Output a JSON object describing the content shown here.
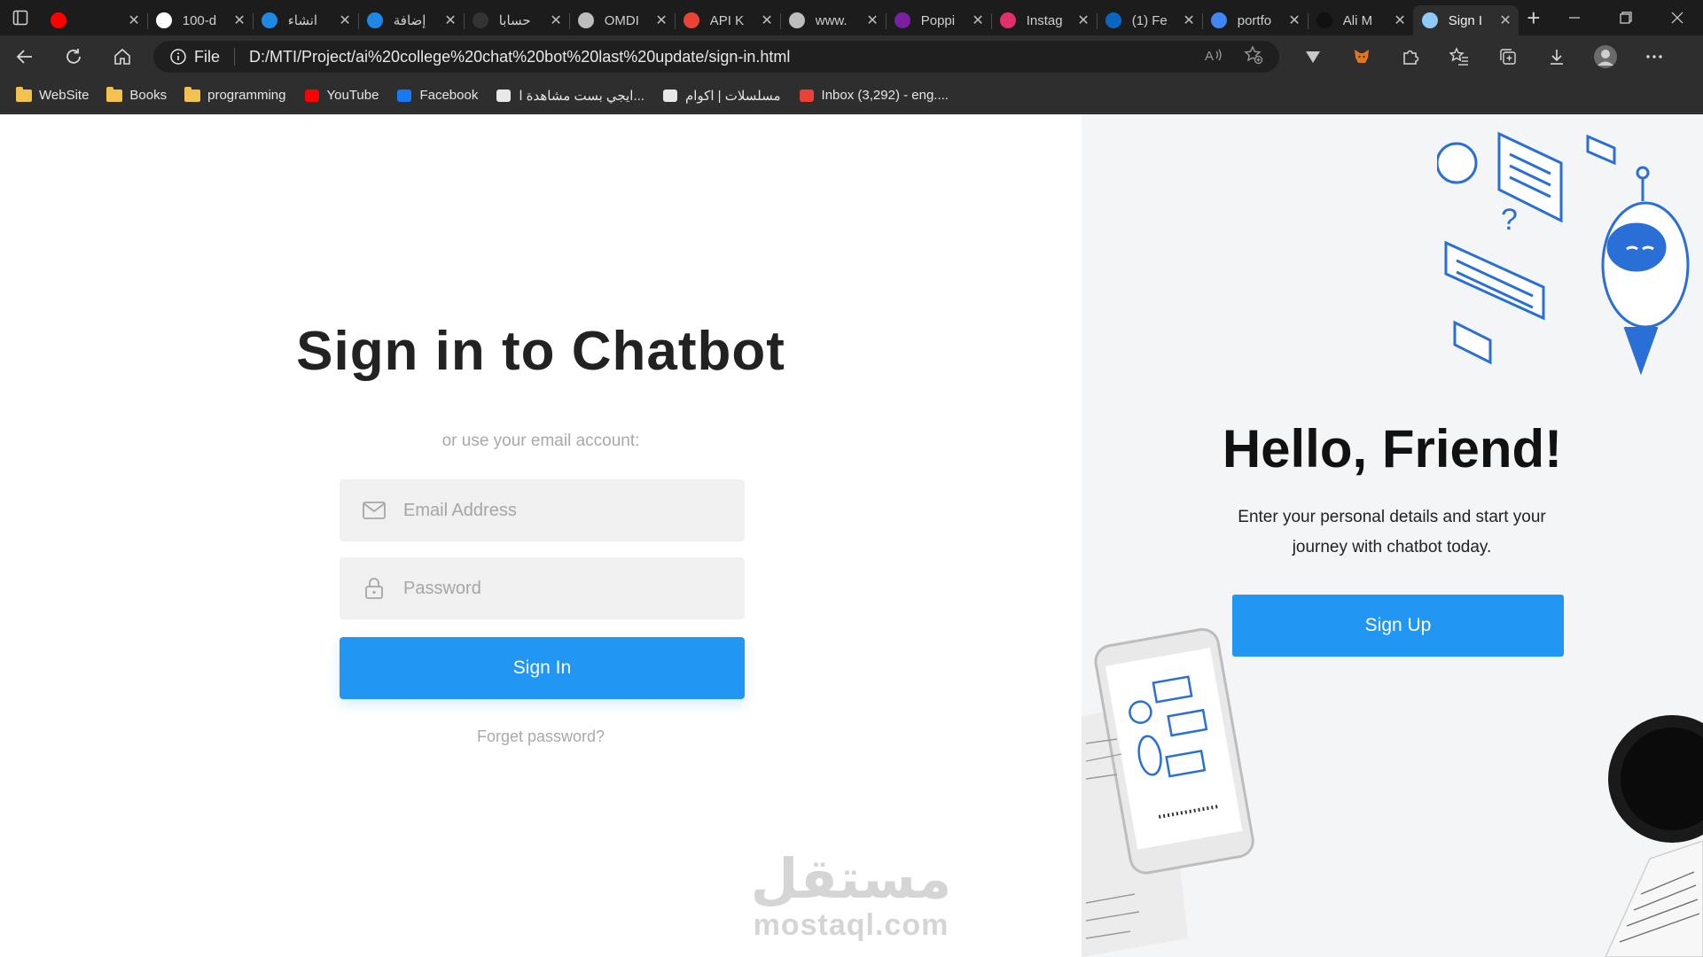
{
  "browser": {
    "tabs": [
      {
        "title": "",
        "favicon": "youtube-icon",
        "color": "#ff0000",
        "active": false
      },
      {
        "title": "100-d",
        "favicon": "github-icon",
        "color": "#ffffff",
        "active": false
      },
      {
        "title": "انشاء",
        "favicon": "circle-blue-icon",
        "color": "#1e88e5",
        "active": false
      },
      {
        "title": "إضافة",
        "favicon": "circle-blue-icon",
        "color": "#1e88e5",
        "active": false
      },
      {
        "title": "حسابا",
        "favicon": "dark-circle-icon",
        "color": "#333333",
        "active": false
      },
      {
        "title": "OMDI",
        "favicon": "globe-icon",
        "color": "#bdbdbd",
        "active": false
      },
      {
        "title": "API K",
        "favicon": "gmail-icon",
        "color": "#ea4335",
        "active": false
      },
      {
        "title": "www.",
        "favicon": "globe-icon",
        "color": "#bdbdbd",
        "active": false
      },
      {
        "title": "Poppi",
        "favicon": "poppins-icon",
        "color": "#7b1fa2",
        "active": false
      },
      {
        "title": "Instag",
        "favicon": "instagram-icon",
        "color": "#e1306c",
        "active": false
      },
      {
        "title": "(1) Fe",
        "favicon": "linkedin-icon",
        "color": "#0a66c2",
        "active": false
      },
      {
        "title": "portfo",
        "favicon": "google-icon",
        "color": "#4285f4",
        "active": false
      },
      {
        "title": "Ali M",
        "favicon": "letter-a-icon",
        "color": "#111111",
        "active": false
      },
      {
        "title": "Sign I",
        "favicon": "robot-icon",
        "color": "#90caf9",
        "active": true
      }
    ],
    "address": {
      "scheme": "File",
      "url": "D:/MTI/Project/ai%20college%20chat%20bot%20last%20update/sign-in.html"
    },
    "bookmarks": [
      {
        "label": "WebSite",
        "icon": "folder-icon"
      },
      {
        "label": "Books",
        "icon": "folder-icon"
      },
      {
        "label": "programming",
        "icon": "folder-icon"
      },
      {
        "label": "YouTube",
        "icon": "youtube-icon"
      },
      {
        "label": "Facebook",
        "icon": "facebook-icon"
      },
      {
        "label": "ايجي بست مشاهدة ا...",
        "icon": "egybest-icon"
      },
      {
        "label": "مسلسلات | اكوام",
        "icon": "akwam-icon"
      },
      {
        "label": "Inbox (3,292) - eng....",
        "icon": "gmail-icon"
      }
    ]
  },
  "signin": {
    "title": "Sign in to Chatbot",
    "subtitle": "or use your email account:",
    "email_placeholder": "Email Address",
    "password_placeholder": "Password",
    "submit_label": "Sign In",
    "forgot_label": "Forget password?"
  },
  "welcome": {
    "title": "Hello, Friend!",
    "text": "Enter your personal details and start your journey with chatbot today.",
    "signup_label": "Sign Up"
  },
  "watermark": {
    "arabic": "مستقل",
    "latin": "mostaql.com"
  },
  "colors": {
    "accent": "#2196f3",
    "page_bg": "#ffffff",
    "panel_bg": "#f4f5f7"
  }
}
